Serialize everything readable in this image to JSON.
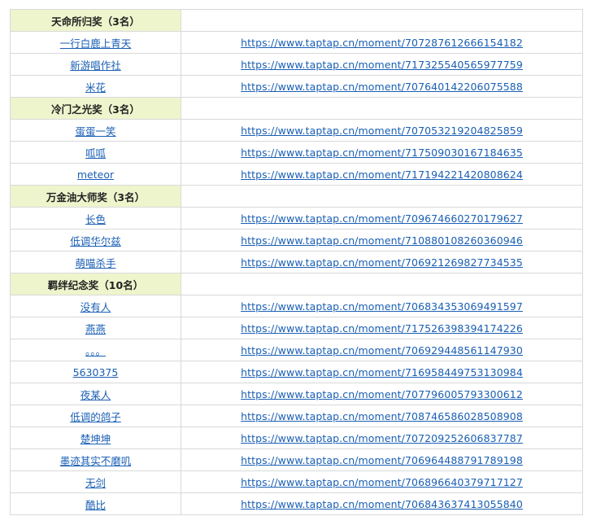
{
  "sections": [
    {
      "title": "天命所归奖（3名）",
      "entries": [
        {
          "name": "一行白鹿上青天",
          "url": "https://www.taptap.cn/moment/707287612666154182"
        },
        {
          "name": "新游唱作社",
          "url": "https://www.taptap.cn/moment/717325540565977759"
        },
        {
          "name": "米花",
          "url": "https://www.taptap.cn/moment/707640142206075588"
        }
      ]
    },
    {
      "title": "冷门之光奖（3名）",
      "entries": [
        {
          "name": "蛋蛋一笑",
          "url": "https://www.taptap.cn/moment/707053219204825859"
        },
        {
          "name": "呱呱",
          "url": "https://www.taptap.cn/moment/717509030167184635"
        },
        {
          "name": "meteor",
          "url": "https://www.taptap.cn/moment/717194221420808624"
        }
      ]
    },
    {
      "title": "万金油大师奖（3名）",
      "entries": [
        {
          "name": "长色",
          "url": "https://www.taptap.cn/moment/709674660270179627"
        },
        {
          "name": "低调华尔兹",
          "url": "https://www.taptap.cn/moment/710880108260360946"
        },
        {
          "name": "萌喵杀手",
          "url": "https://www.taptap.cn/moment/706921269827734535"
        }
      ]
    },
    {
      "title": "羁绊纪念奖（10名）",
      "entries": [
        {
          "name": "没有人",
          "url": "https://www.taptap.cn/moment/706834353069491597"
        },
        {
          "name": "燕燕",
          "url": "https://www.taptap.cn/moment/717526398394174226"
        },
        {
          "name": "。。。",
          "url": "https://www.taptap.cn/moment/706929448561147930"
        },
        {
          "name": "5630375",
          "url": "https://www.taptap.cn/moment/716958449753130984"
        },
        {
          "name": "夜某人",
          "url": "https://www.taptap.cn/moment/707796005793300612"
        },
        {
          "name": "低调的鸽子",
          "url": "https://www.taptap.cn/moment/708746586028508908"
        },
        {
          "name": "楚坤坤",
          "url": "https://www.taptap.cn/moment/707209252606837787"
        },
        {
          "name": "墨迹其实不磨叽",
          "url": "https://www.taptap.cn/moment/706964488791789198"
        },
        {
          "name": "无剑",
          "url": "https://www.taptap.cn/moment/706896640379717127"
        },
        {
          "name": "酷比",
          "url": "https://www.taptap.cn/moment/706843637413055840"
        }
      ]
    }
  ]
}
